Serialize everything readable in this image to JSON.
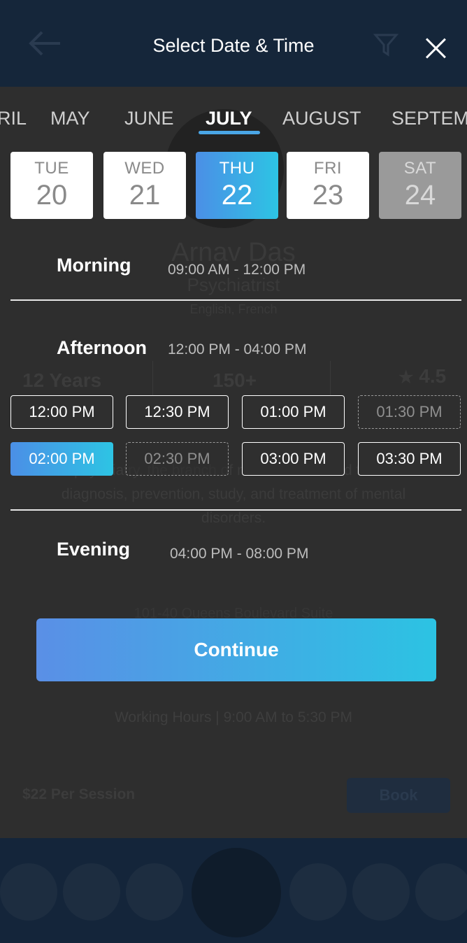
{
  "modal": {
    "title": "Select Date & Time",
    "months": [
      "RIL",
      "MAY",
      "JUNE",
      "JULY",
      "AUGUST",
      "SEPTEM"
    ],
    "active_month": "JULY",
    "days": [
      {
        "dow": "TUE",
        "num": "20",
        "state": "available"
      },
      {
        "dow": "WED",
        "num": "21",
        "state": "available"
      },
      {
        "dow": "THU",
        "num": "22",
        "state": "selected"
      },
      {
        "dow": "FRI",
        "num": "23",
        "state": "available"
      },
      {
        "dow": "SAT",
        "num": "24",
        "state": "disabled"
      }
    ],
    "morning": {
      "label": "Morning",
      "range": "09:00 AM - 12:00 PM"
    },
    "afternoon": {
      "label": "Afternoon",
      "range": "12:00 PM - 04:00 PM",
      "slots": [
        {
          "time": "12:00 PM",
          "state": "available"
        },
        {
          "time": "12:30 PM",
          "state": "available"
        },
        {
          "time": "01:00 PM",
          "state": "available"
        },
        {
          "time": "01:30 PM",
          "state": "unavailable"
        },
        {
          "time": "02:00 PM",
          "state": "selected"
        },
        {
          "time": "02:30 PM",
          "state": "unavailable"
        },
        {
          "time": "03:00 PM",
          "state": "available"
        },
        {
          "time": "03:30 PM",
          "state": "available"
        }
      ]
    },
    "evening": {
      "label": "Evening",
      "range": "04:00 PM - 08:00 PM"
    },
    "continue_label": "Continue"
  },
  "background": {
    "doctor_name": "Arnav Das",
    "role": "Psychiatrist",
    "languages": "English, French",
    "experience": "12 Years",
    "reviews": "150+",
    "rating": "4.5",
    "rating_icon": "star-icon",
    "description": "psychiatry, the branch of medicine devoted to the diagnosis, prevention, study, and treatment of mental disorders.",
    "address": "101-40 Queens Boulevard Suite",
    "working_hours": "Working Hours | 9:00 AM to 5:30 PM",
    "price": "$22 Per Session",
    "book_label": "Book"
  },
  "colors": {
    "accent_start": "#4b8fe6",
    "accent_end": "#2dc4e4",
    "overlay": "#2f2f2f"
  }
}
